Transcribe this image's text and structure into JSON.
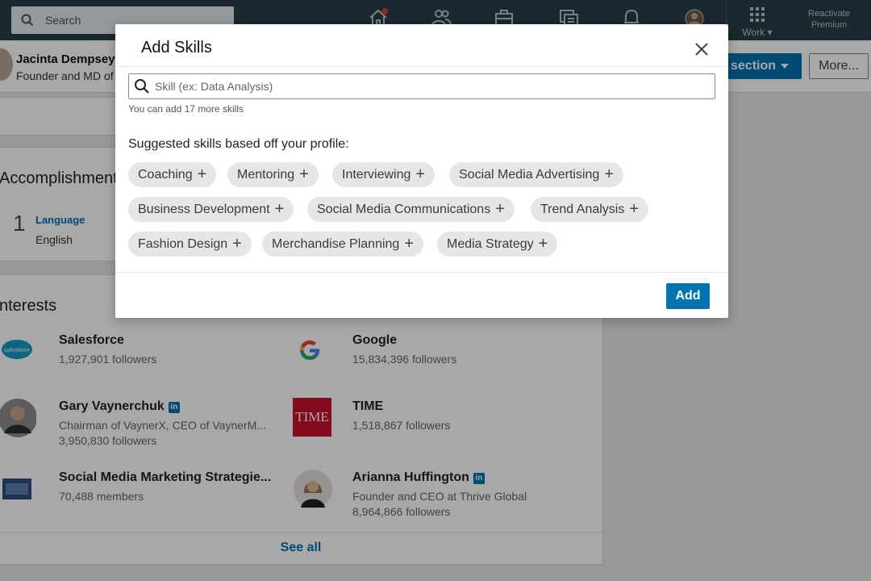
{
  "nav": {
    "search_placeholder": "Search",
    "work_label": "Work",
    "reactivate_line1": "Reactivate",
    "reactivate_line2": "Premium",
    "icons": [
      "home-icon",
      "my-network-icon",
      "jobs-icon",
      "messaging-icon",
      "notifications-icon",
      "me-avatar-icon",
      "work-grid-icon"
    ]
  },
  "profile": {
    "name": "Jacinta Dempsey",
    "headline": "Founder and MD of",
    "add_section_label": "section",
    "more_label": "More..."
  },
  "accomplishments": {
    "title": "Accomplishments",
    "count": "1",
    "category": "Language",
    "value": "English"
  },
  "interests": {
    "title": "nterests",
    "items": [
      {
        "name": "Salesforce",
        "line1": "1,927,901 followers",
        "line2": ""
      },
      {
        "name": "Google",
        "line1": "15,834,396 followers",
        "line2": ""
      },
      {
        "name": "Gary Vaynerchuk",
        "line1": "Chairman of VaynerX, CEO of VaynerM...",
        "line2": "3,950,830 followers"
      },
      {
        "name": "TIME",
        "line1": "1,518,867 followers",
        "line2": ""
      },
      {
        "name": "Social Media Marketing Strategie...",
        "line1": "70,488 members",
        "line2": ""
      },
      {
        "name": "Arianna Huffington",
        "line1": "Founder and CEO at Thrive Global",
        "line2": "8,964,866 followers"
      }
    ],
    "see_all": "See all",
    "in_badge": "in",
    "time_logo_text": "TIME"
  },
  "modal": {
    "title": "Add Skills",
    "input_placeholder": "Skill (ex: Data Analysis)",
    "hint": "You can add 17 more skills",
    "suggest_label": "Suggested skills based off your profile:",
    "chips": [
      "Coaching",
      "Mentoring",
      "Interviewing",
      "Social Media Advertising",
      "Business Development",
      "Social Media Communications",
      "Trend Analysis",
      "Fashion Design",
      "Merchandise Planning",
      "Media Strategy"
    ],
    "chip_plus": "+",
    "add_label": "Add"
  },
  "colors": {
    "nav_bg": "#283e4a",
    "accent": "#0073b1",
    "chip_bg": "#e6e6e6"
  }
}
